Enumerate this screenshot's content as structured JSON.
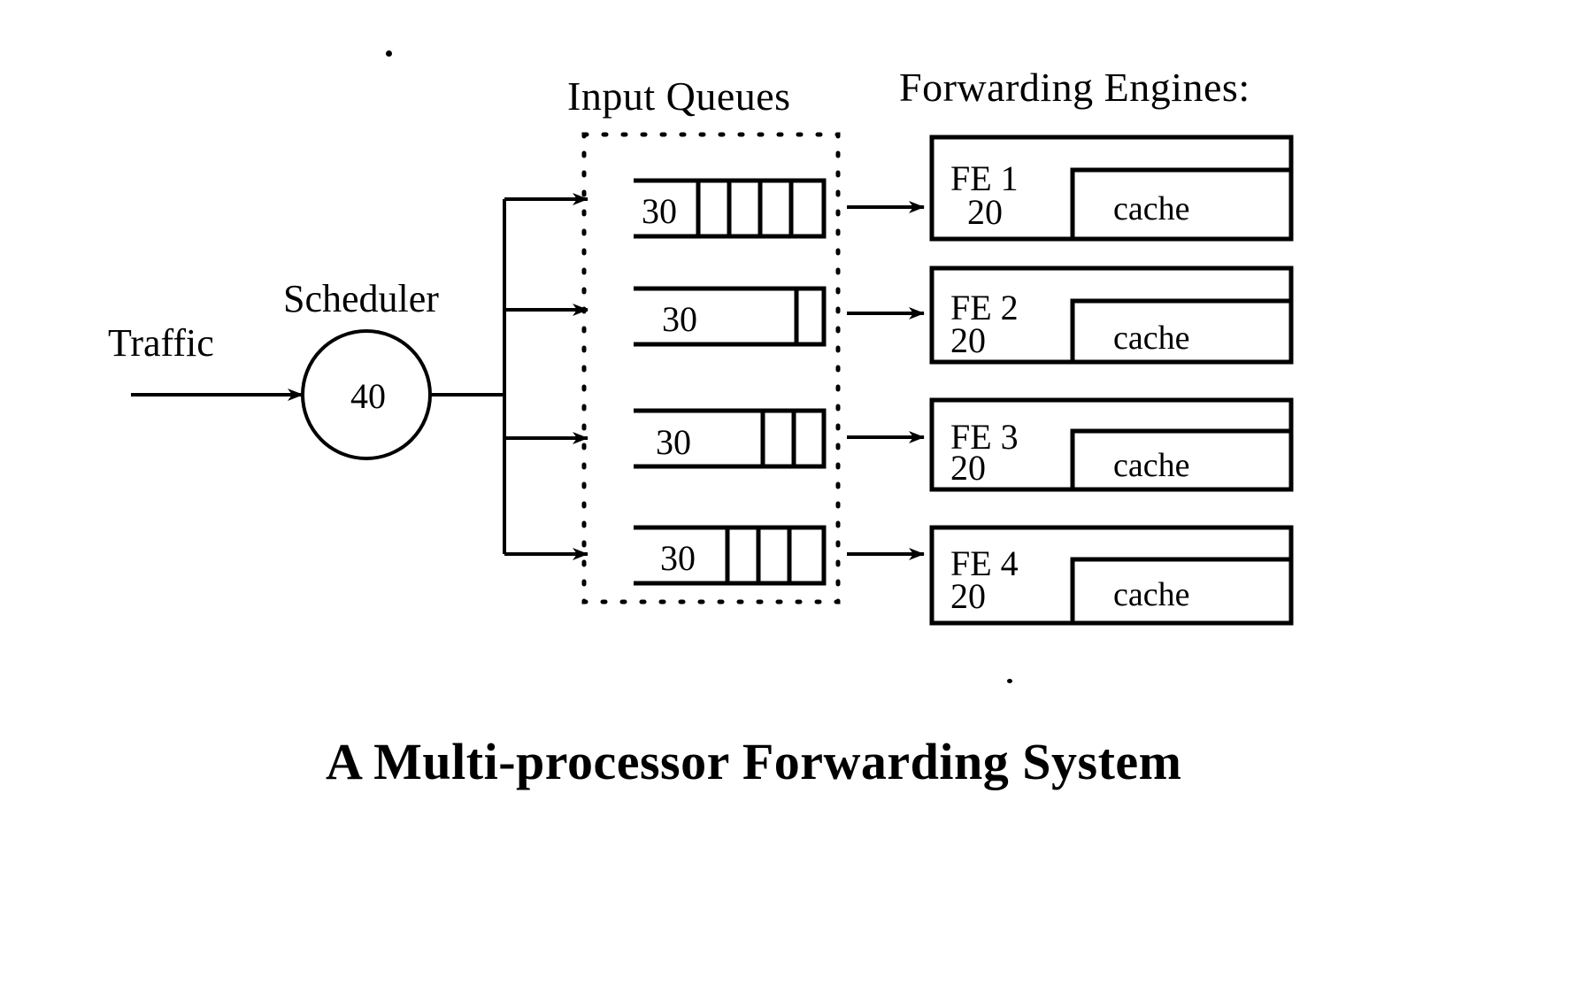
{
  "figure": {
    "caption": "A Multi-processor Forwarding System",
    "headings": {
      "input_queues": "Input Queues",
      "forwarding_engines": "Forwarding Engines:"
    },
    "traffic_label": "Traffic",
    "scheduler": {
      "label": "Scheduler",
      "value": "40"
    },
    "queues": [
      {
        "value": "30",
        "cells": 4
      },
      {
        "value": "30",
        "cells": 1
      },
      {
        "value": "30",
        "cells": 2
      },
      {
        "value": "30",
        "cells": 3
      }
    ],
    "engines": [
      {
        "name": "FE 1",
        "value": "20",
        "cache_label": "cache"
      },
      {
        "name": "FE 2",
        "value": "20",
        "cache_label": "cache"
      },
      {
        "name": "FE 3",
        "value": "20",
        "cache_label": "cache"
      },
      {
        "name": "FE 4",
        "value": "20",
        "cache_label": "cache"
      }
    ],
    "colors": {
      "ink": "#000000",
      "paper": "#ffffff"
    }
  }
}
